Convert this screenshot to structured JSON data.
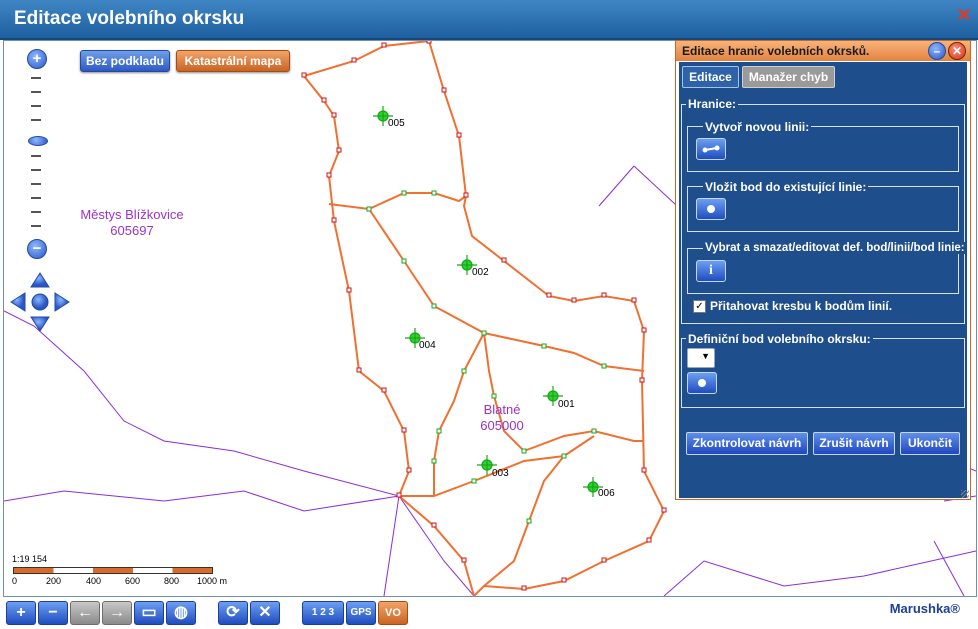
{
  "window": {
    "title": "Editace volebního okrsku",
    "close_icon": "close-icon"
  },
  "map": {
    "buttons": {
      "no_base": "Bez podkladu",
      "cadastral": "Katastrální mapa"
    },
    "places": [
      {
        "name": "Městys Blížkovice",
        "code": "605697"
      },
      {
        "name": "Blatné",
        "code": "605000"
      }
    ],
    "district_labels": [
      "005",
      "002",
      "004",
      "001",
      "003",
      "006"
    ],
    "scale": {
      "ratio": "1:19 154",
      "ticks": [
        "0",
        "200",
        "400",
        "600",
        "800",
        "1000 m"
      ]
    },
    "zoom": {
      "plus": "+",
      "minus": "−"
    }
  },
  "panel": {
    "title": "Editace hranic volebních okrsků.",
    "tabs": [
      "Editace",
      "Manažer chyb"
    ],
    "hranice_label": "Hranice:",
    "create_line_label": "Vytvoř novou linii:",
    "insert_point_label": "Vložit bod do existující linie:",
    "select_edit_label": "Vybrat a smazat/editovat def. bod/linii/bod linie:",
    "snap_label": "Přitahovat kresbu k bodům linií.",
    "snap_checked": true,
    "def_point_label": "Definiční bod volebního okrsku:",
    "btn_check": "Zkontrolovat návrh",
    "btn_cancel": "Zrušit návrh",
    "btn_end": "Ukončit",
    "info_glyph": "i"
  },
  "toolbar": {
    "gps_label": "GPS",
    "vo_label": "VO",
    "measure_label": "1 2 3"
  },
  "brand": {
    "name": "Marushka®"
  },
  "colors": {
    "title_bar": "#2a6fb0",
    "boundary": "#f07030",
    "municipal": "#8a2be2",
    "panel_bg": "#1f4e8c",
    "panel_header": "#f2a15c"
  }
}
